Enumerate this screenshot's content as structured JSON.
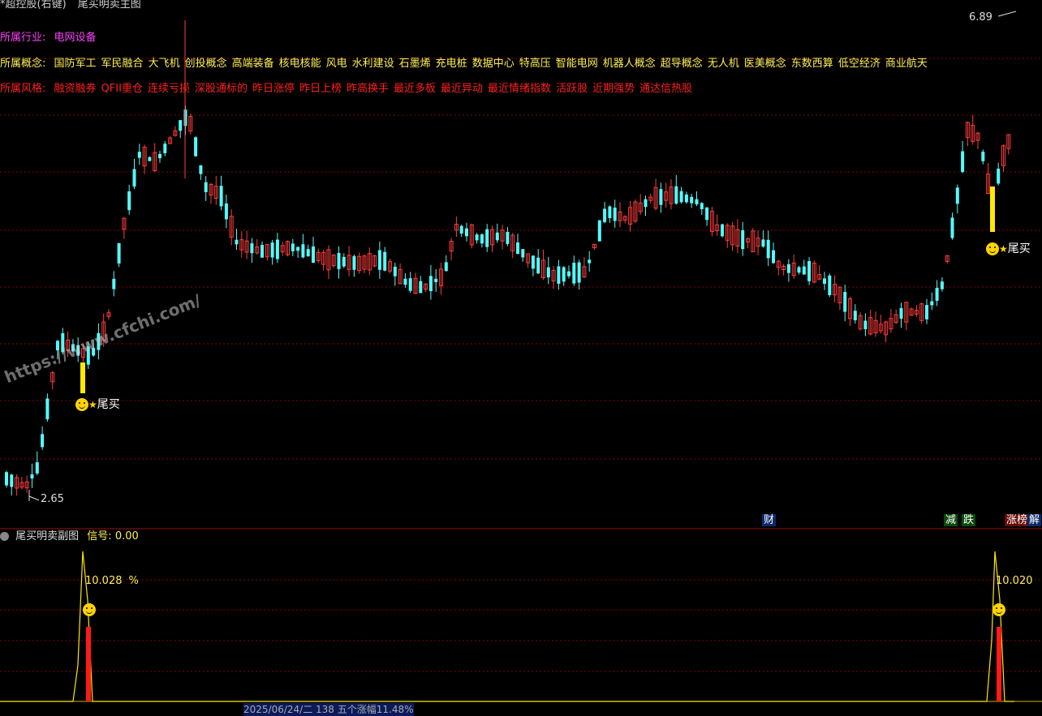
{
  "header": {
    "stock_name": "*超控股(右键)",
    "indicator_title": "尾买明卖主图"
  },
  "info": {
    "industry_label": "所属行业:",
    "industry_value": "电网设备",
    "concept_label": "所属概念:",
    "concept_values": [
      "国防军工",
      "军民融合",
      "大飞机",
      "创投概念",
      "高端装备",
      "核电核能",
      "风电",
      "水利建设",
      "石墨烯",
      "充电桩",
      "数据中心",
      "特高压",
      "智能电网",
      "机器人概念",
      "超导概念",
      "无人机",
      "医美概念",
      "东数西算",
      "低空经济",
      "商业航天"
    ],
    "style_label": "所属风格:",
    "style_values": [
      "融资融券",
      "QFII重仓",
      "连续亏损",
      "深股通标的",
      "昨日涨停",
      "昨日上榜",
      "昨高换手",
      "最近多板",
      "最近异动",
      "最近情绪指数",
      "活跃股",
      "近期强势",
      "通达信热股"
    ]
  },
  "price_labels": {
    "high": "6.89",
    "low": "2.65"
  },
  "signals": {
    "buy_label": "尾买"
  },
  "event_tags": [
    {
      "text": "财",
      "color": "#3070ff"
    },
    {
      "text": "减",
      "color": "#20c020"
    },
    {
      "text": "跌",
      "color": "#20c020"
    },
    {
      "text": "涨榜",
      "color": "#ff2020"
    },
    {
      "text": "解",
      "color": "#4080ff"
    }
  ],
  "sub_panel": {
    "title": "尾买明卖副图",
    "signal_label": "信号:",
    "signal_value": "0.00",
    "peak1": "10.028",
    "peak1_unit": "%",
    "peak2": "10.020"
  },
  "watermark": "https://www.cfchi.com/",
  "footer": {
    "date_text": "2025/06/24/二 138 五个涨幅11.48%"
  },
  "colors": {
    "up": "#ff3b3b",
    "down": "#54fcfc",
    "signal": "#ffe800",
    "grid": "#8b0000",
    "background": "#000000"
  }
}
